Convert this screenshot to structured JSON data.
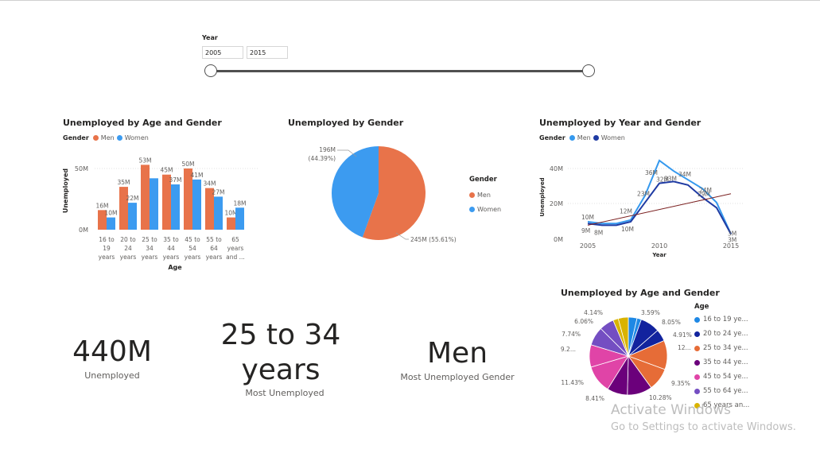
{
  "slicer": {
    "title": "Year",
    "start": "2005",
    "end": "2015",
    "range_fraction": [
      0,
      1
    ]
  },
  "bar_visual": {
    "title": "Unemployed by Age and Gender",
    "legend_title": "Gender",
    "ylabel": "Unemployed",
    "xlabel": "Age",
    "yticks": [
      "50M",
      "0M"
    ]
  },
  "pie_gender": {
    "title": "Unemployed by Gender",
    "legend_title": "Gender",
    "women_label_value": "196M",
    "women_label_pct": "(44.39%)",
    "men_label": "245M (55.61%)"
  },
  "line_visual": {
    "title": "Unemployed by Year and Gender",
    "legend_title": "Gender",
    "ylabel": "Unemployed",
    "xlabel": "Year",
    "yticks": [
      "40M",
      "20M",
      "0M"
    ],
    "xticks": [
      "2005",
      "2010",
      "2015"
    ]
  },
  "pie_age": {
    "title": "Unemployed by Age and Gender",
    "legend_title": "Age",
    "legend_items": [
      "16 to 19 ye...",
      "20 to 24 ye...",
      "25 to 34 ye...",
      "35 to 44 ye...",
      "45 to 54 ye...",
      "55 to 64 ye...",
      "65 years an..."
    ],
    "labels": [
      "4.14%",
      "3.59%",
      "6.06%",
      "8.05%",
      "7.74%",
      "4.91%",
      "9.2...",
      "12...",
      "11.43%",
      "9.35%",
      "8.41%",
      "10.28%"
    ]
  },
  "cards": [
    {
      "value": "440M",
      "label": "Unemployed"
    },
    {
      "value_line1": "25 to 34",
      "value_line2": "years",
      "label": "Most Unemployed"
    },
    {
      "value": "Men",
      "label": "Most Unemployed Gender"
    }
  ],
  "watermark": {
    "line1": "Activate Windows",
    "line2": "Go to Settings to activate Windows."
  },
  "colors": {
    "men": "#E8734A",
    "women": "#3C9BF0",
    "line_men": "#3599EE",
    "line_women": "#1F3BA3",
    "trend": "#7A1F1F",
    "age": [
      "#1E88E5",
      "#12239E",
      "#E66C37",
      "#6B007B",
      "#E044A7",
      "#744EC2",
      "#D9B300"
    ]
  },
  "chart_data": [
    {
      "type": "bar",
      "title": "Unemployed by Age and Gender",
      "xlabel": "Age",
      "ylabel": "Unemployed",
      "categories": [
        "16 to 19 years",
        "20 to 24 years",
        "25 to 34 years",
        "35 to 44 years",
        "45 to 54 years",
        "55 to 64 years",
        "65 years and ..."
      ],
      "category_lines": [
        [
          "16 to",
          "19",
          "years"
        ],
        [
          "20 to",
          "24",
          "years"
        ],
        [
          "25 to",
          "34",
          "years"
        ],
        [
          "35 to",
          "44",
          "years"
        ],
        [
          "45 to",
          "54",
          "years"
        ],
        [
          "55 to",
          "64",
          "years"
        ],
        [
          "65",
          "years",
          "and ..."
        ]
      ],
      "series": [
        {
          "name": "Men",
          "values": [
            16,
            35,
            53,
            45,
            50,
            34,
            10
          ],
          "labels": [
            "16M",
            "35M",
            "53M",
            "45M",
            "50M",
            "34M",
            "10M"
          ]
        },
        {
          "name": "Women",
          "values": [
            10,
            22,
            42,
            37,
            41,
            27,
            18
          ],
          "labels": [
            "10M",
            "22M",
            "",
            "37M",
            "41M",
            "27M",
            "18M"
          ]
        }
      ],
      "ylim": [
        0,
        57
      ],
      "legend": "top-left"
    },
    {
      "type": "pie",
      "title": "Unemployed by Gender",
      "categories": [
        "Men",
        "Women"
      ],
      "values": [
        245,
        196
      ],
      "percentages": [
        55.61,
        44.39
      ],
      "legend": "right"
    },
    {
      "type": "line",
      "title": "Unemployed by Year and Gender",
      "xlabel": "Year",
      "ylabel": "Unemployed",
      "x": [
        2005,
        2006,
        2007,
        2008,
        2009,
        2010,
        2011,
        2012,
        2013,
        2014,
        2015
      ],
      "series": [
        {
          "name": "Men",
          "values": [
            10,
            9,
            9,
            11,
            25,
            45,
            39,
            34,
            29,
            21,
            3
          ]
        },
        {
          "name": "Women",
          "values": [
            9,
            8,
            8,
            10,
            21,
            32,
            33,
            31,
            24,
            18,
            3
          ]
        }
      ],
      "point_labels": [
        {
          "x": 2005,
          "y": 10,
          "text": "10M"
        },
        {
          "x": 2005,
          "y": 9,
          "text": "9M"
        },
        {
          "x": 2006,
          "y": 8,
          "text": "8M"
        },
        {
          "x": 2008,
          "y": 10,
          "text": "10M"
        },
        {
          "x": 2008,
          "y": 13,
          "text": "12M"
        },
        {
          "x": 2009,
          "y": 23,
          "text": "23M"
        },
        {
          "x": 2010,
          "y": 36,
          "text": "36M"
        },
        {
          "x": 2010,
          "y": 32,
          "text": "32M"
        },
        {
          "x": 2011,
          "y": 33,
          "text": "33M"
        },
        {
          "x": 2012,
          "y": 34,
          "text": "34M"
        },
        {
          "x": 2013,
          "y": 29,
          "text": "29M"
        },
        {
          "x": 2013,
          "y": 24,
          "text": "24M"
        },
        {
          "x": 2015,
          "y": 3,
          "text": "3M"
        },
        {
          "x": 2015,
          "y": 3,
          "text": "3M"
        }
      ],
      "trendline": {
        "x": [
          2005,
          2015
        ],
        "y": [
          8,
          26
        ]
      },
      "ylim": [
        0,
        47
      ],
      "legend": "top-left"
    },
    {
      "type": "pie",
      "title": "Unemployed by Age and Gender",
      "categories": [
        "16 to 19 years Men",
        "16 to 19 years Women",
        "20 to 24 years Men",
        "20 to 24 years Women",
        "25 to 34 years Men",
        "25 to 34 years Women",
        "35 to 44 years Men",
        "35 to 44 years Women",
        "45 to 54 years Men",
        "45 to 54 years Women",
        "55 to 64 years Men",
        "55 to 64 years Women",
        "65 years and over Men",
        "65 years and over Women"
      ],
      "values": [
        3.59,
        1.8,
        8.05,
        4.91,
        12.0,
        9.35,
        10.28,
        8.41,
        11.43,
        9.2,
        7.74,
        6.06,
        2.2,
        4.14
      ],
      "legend": "right"
    }
  ]
}
